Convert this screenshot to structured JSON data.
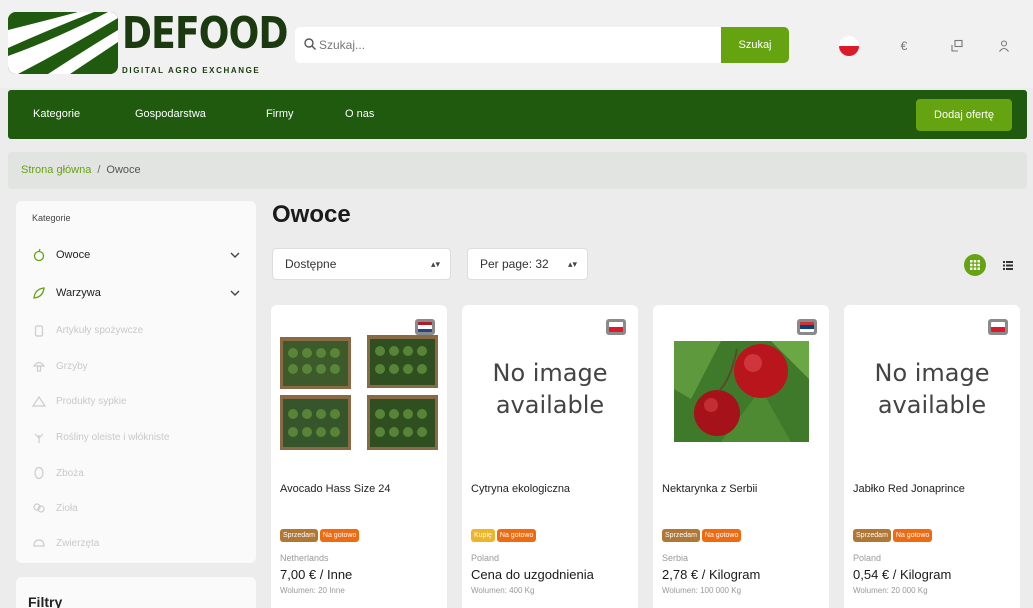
{
  "brand": {
    "name": "DEFOOD",
    "tagline": "DIGITAL AGRO EXCHANGE",
    "color": "#1f5a0e",
    "accent": "#66a311"
  },
  "search": {
    "placeholder": "Szukaj...",
    "value": "",
    "button": "Szukaj"
  },
  "header_icons": [
    "flag-pl-icon",
    "currency-euro-icon",
    "compare-icon",
    "user-icon"
  ],
  "header_currency": "€",
  "nav": {
    "items": [
      "Kategorie",
      "Gospodarstwa",
      "Firmy",
      "O nas"
    ],
    "cta": "Dodaj ofertę"
  },
  "breadcrumb": {
    "home": "Strona główna",
    "separator": "/",
    "current": "Owoce"
  },
  "sidebar": {
    "title": "Kategorie",
    "categories": [
      {
        "label": "Owoce",
        "enabled": true,
        "icon": "apple-icon"
      },
      {
        "label": "Warzywa",
        "enabled": true,
        "icon": "leaf-icon"
      },
      {
        "label": "Artykuły spożywcze",
        "enabled": false,
        "icon": "jar-icon"
      },
      {
        "label": "Grzyby",
        "enabled": false,
        "icon": "mushroom-icon"
      },
      {
        "label": "Produkty sypkie",
        "enabled": false,
        "icon": "pile-icon"
      },
      {
        "label": "Rośliny oleiste i włókniste",
        "enabled": false,
        "icon": "plant-icon"
      },
      {
        "label": "Zboża",
        "enabled": false,
        "icon": "grain-icon"
      },
      {
        "label": "Zioła",
        "enabled": false,
        "icon": "herb-icon"
      },
      {
        "label": "Zwierzęta",
        "enabled": false,
        "icon": "animal-icon"
      }
    ],
    "filters_title": "Filtry"
  },
  "main": {
    "title": "Owoce",
    "availability_select": "Dostępne",
    "per_page_select": "Per page: 32"
  },
  "products": [
    {
      "title": "Avocado Hass Size 24",
      "flag": "nl",
      "image": "avocado",
      "badges": [
        "Sprzedam",
        "Na gotowo"
      ],
      "country": "Netherlands",
      "price": "7,00 € / Inne",
      "volume": "Wolumen: 20 Inne"
    },
    {
      "title": "Cytryna ekologiczna",
      "flag": "pl",
      "image": "none",
      "badges": [
        "Kupię",
        "Na gotowo"
      ],
      "country": "Poland",
      "price": "Cena do uzgodnienia",
      "volume": "Wolumen: 400 Kg"
    },
    {
      "title": "Nektarynka z Serbii",
      "flag": "rs",
      "image": "nectarine",
      "badges": [
        "Sprzedam",
        "Na gotowo"
      ],
      "country": "Serbia",
      "price": "2,78 € / Kilogram",
      "volume": "Wolumen: 100 000 Kg"
    },
    {
      "title": "Jabłko Red Jonaprince",
      "flag": "pl",
      "image": "none",
      "badges": [
        "Sprzedam",
        "Na gotowo"
      ],
      "country": "Poland",
      "price": "0,54 € / Kilogram",
      "volume": "Wolumen: 20 000 Kg"
    }
  ],
  "no_image_text": [
    "No image",
    "available"
  ]
}
